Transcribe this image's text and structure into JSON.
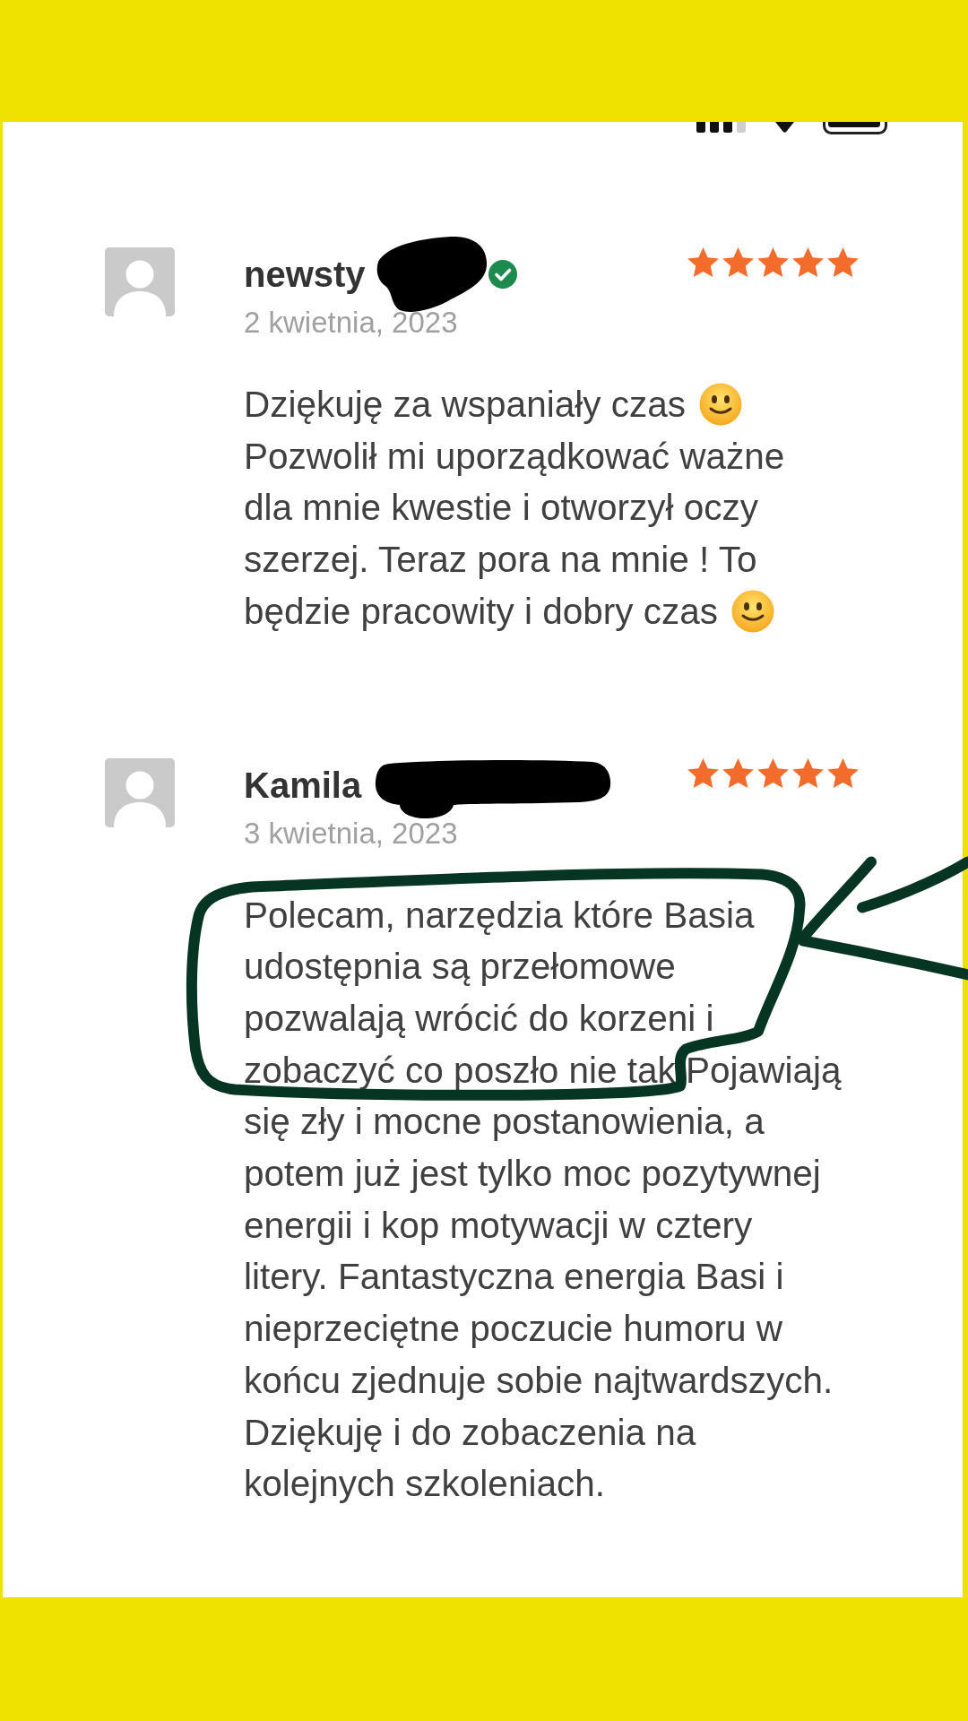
{
  "reviews": [
    {
      "author": "newsty",
      "redacted": true,
      "verified": true,
      "stars": 5,
      "date": "2 kwietnia, 2023",
      "body": [
        {
          "kind": "text",
          "circled": false,
          "text": "Dziękuję za wspaniały czas"
        },
        {
          "kind": "emoji",
          "circled": false
        },
        {
          "kind": "text",
          "circled": false,
          "text": "Pozwolił mi uporządkować ważne\ndla mnie kwestie i otworzył oczy\nszerzej. Teraz pora na mnie ! To"
        },
        {
          "kind": "text",
          "circled": false,
          "text": "będzie pracowity i dobry czas"
        },
        {
          "kind": "emoji",
          "circled": false
        }
      ]
    },
    {
      "author": "Kamila",
      "redacted": true,
      "verified": false,
      "stars": 5,
      "date": "3 kwietnia, 2023",
      "body": [
        {
          "kind": "text",
          "circled": true,
          "text": "Polecam, narzędzia które Basia\nudostępnia są przełomowe\npozwalają wrócić do korzeni i"
        },
        {
          "kind": "text",
          "circled": true,
          "text": "zobaczyć co poszło nie tak"
        },
        {
          "kind": "text",
          "circled": false,
          "text": "Pojawiają"
        },
        {
          "kind": "text",
          "circled": false,
          "text": "się zły i mocne postanowienia, a\npotem już jest tylko moc pozytywnej\nenergii i kop motywacji w cztery\nlitery. Fantastyczna energia Basi i\nnieprzeciętne poczucie humoru w\nkońcu zjednuje sobie najtwardszych.\nDziękuję i do zobaczenia na\nkolejnych szkoleniach."
        }
      ]
    }
  ]
}
